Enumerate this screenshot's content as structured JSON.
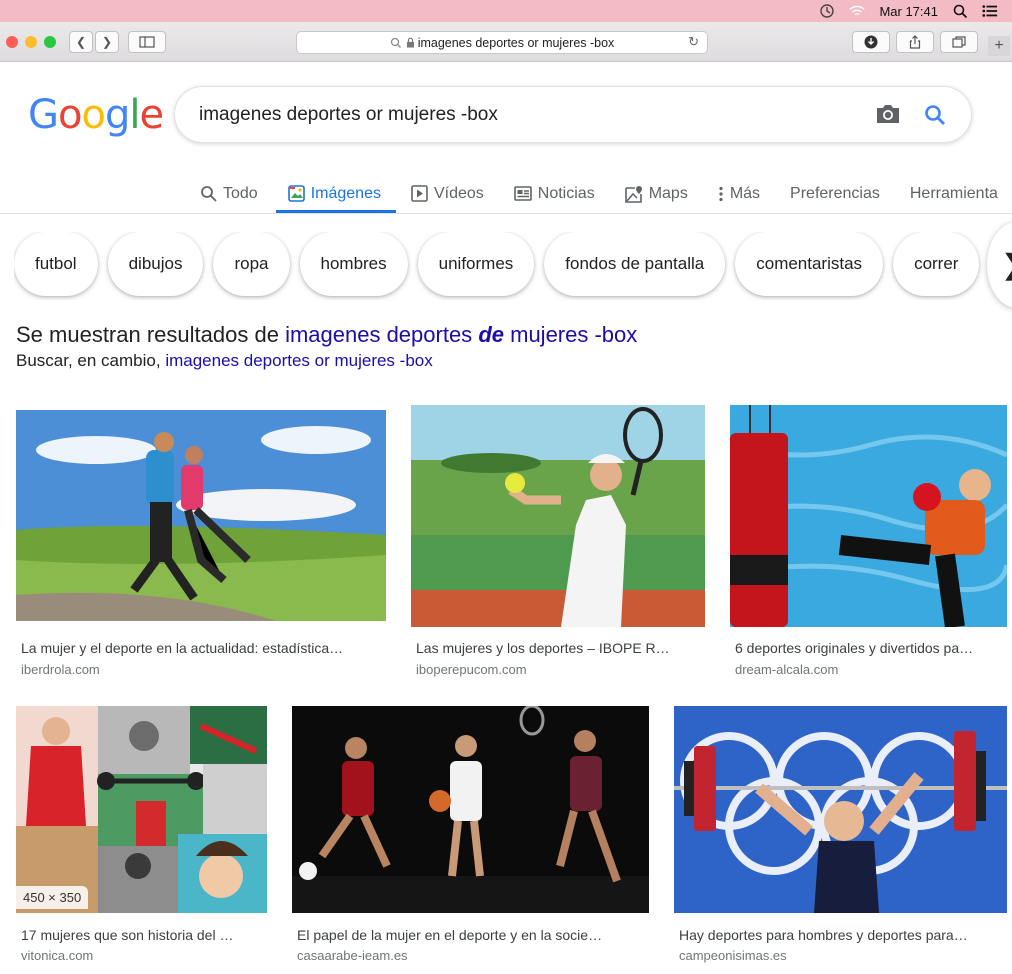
{
  "menubar": {
    "clock": "Mar 17:41"
  },
  "browser": {
    "url": "imagenes deportes or mujeres -box"
  },
  "google": {
    "logo": "Google",
    "query": "imagenes deportes or mujeres -box",
    "tabs": [
      {
        "label": "Todo",
        "icon": "search-icon"
      },
      {
        "label": "Imágenes",
        "icon": "image-icon"
      },
      {
        "label": "Vídeos",
        "icon": "play-icon"
      },
      {
        "label": "Noticias",
        "icon": "news-icon"
      },
      {
        "label": "Maps",
        "icon": "map-icon"
      },
      {
        "label": "Más",
        "icon": "more-vert-icon"
      },
      {
        "label": "Preferencias"
      },
      {
        "label": "Herramienta"
      }
    ],
    "chips": [
      "futbol",
      "dibujos",
      "ropa",
      "hombres",
      "uniformes",
      "fondos de pantalla",
      "comentaristas",
      "correr"
    ]
  },
  "correction": {
    "prefix": "Se muestran resultados de",
    "link_a": "imagenes deportes",
    "link_b": "de",
    "link_c": "mujeres -box",
    "instead_prefix": "Buscar, en cambio,",
    "instead_link": "imagenes deportes or mujeres -box"
  },
  "results": [
    {
      "caption": "La mujer y el deporte en la actualidad: estadística…",
      "source": "iberdrola.com"
    },
    {
      "caption": "Las mujeres y los deportes – IBOPE R…",
      "source": "iboperepucom.com"
    },
    {
      "caption": "6 deportes originales y divertidos pa…",
      "source": "dream-alcala.com"
    },
    {
      "caption": "17 mujeres que son historia del …",
      "source": "vitonica.com",
      "dimensions": "450 × 350"
    },
    {
      "caption": "El papel de la mujer en el deporte y en la socie…",
      "source": "casaarabe-ieam.es"
    },
    {
      "caption": "Hay deportes para hombres y deportes para…",
      "source": "campeonisimas.es"
    }
  ],
  "colors": {
    "accent": "#1a73e8",
    "link": "#1a0dab",
    "menubar": "#f3bcc4"
  }
}
